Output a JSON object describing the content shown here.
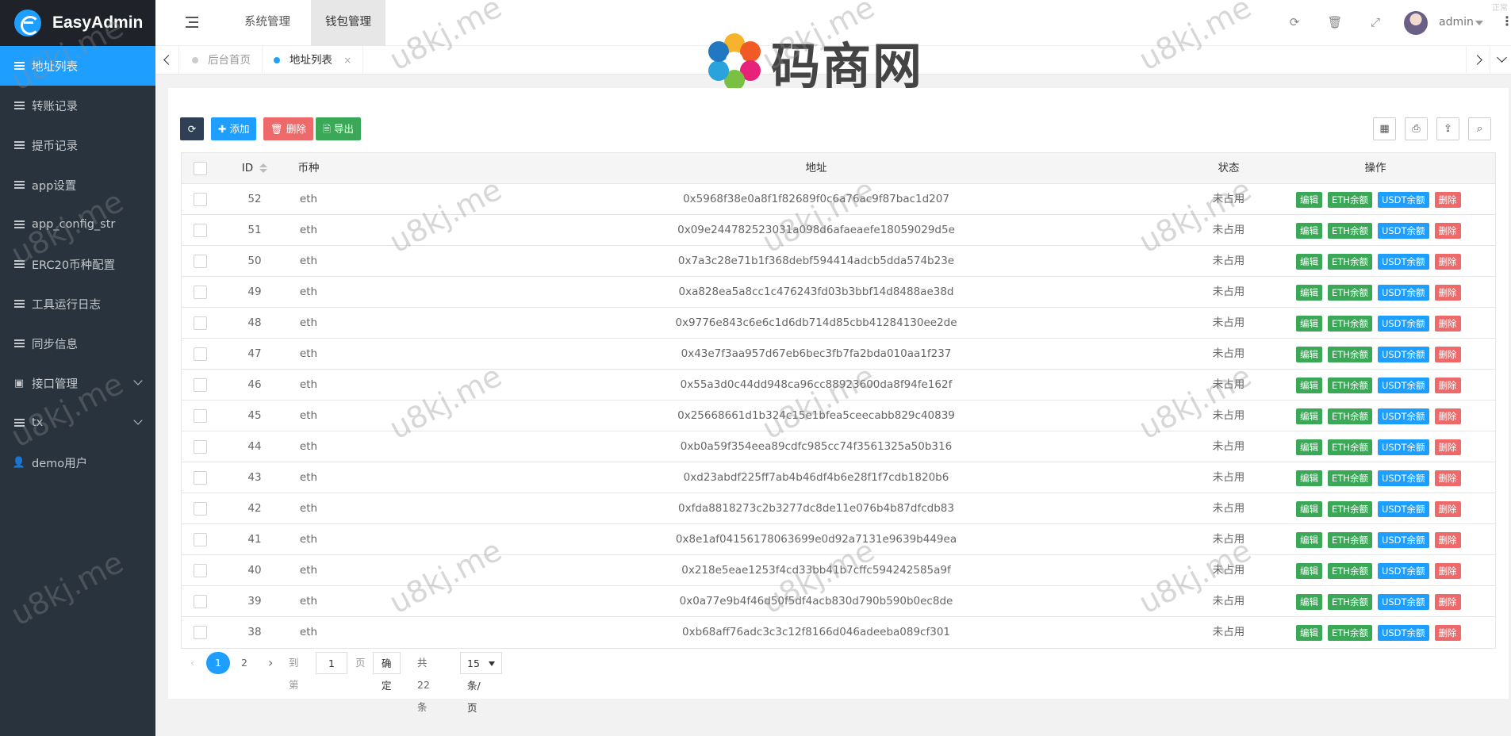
{
  "app": {
    "name": "EasyAdmin"
  },
  "sidebar": {
    "items": [
      {
        "label": "地址列表",
        "active": true,
        "icon": "list-icon"
      },
      {
        "label": "转账记录",
        "icon": "list-icon"
      },
      {
        "label": "提币记录",
        "icon": "list-icon"
      },
      {
        "label": "app设置",
        "icon": "list-icon"
      },
      {
        "label": "app_config_str",
        "icon": "list-icon"
      },
      {
        "label": "ERC20币种配置",
        "icon": "list-icon"
      },
      {
        "label": "工具运行日志",
        "icon": "list-icon"
      },
      {
        "label": "同步信息",
        "icon": "list-icon"
      },
      {
        "label": "接口管理",
        "icon": "id-card-icon",
        "expandable": true
      },
      {
        "label": "tx",
        "icon": "list-icon",
        "expandable": true
      },
      {
        "label": "demo用户",
        "icon": "user-icon"
      }
    ]
  },
  "header": {
    "tabs": [
      {
        "label": "系统管理"
      },
      {
        "label": "钱包管理",
        "active": true
      }
    ],
    "user": "admin",
    "corner_text": "正常"
  },
  "tabbar": {
    "tabs": [
      {
        "label": "后台首页"
      },
      {
        "label": "地址列表",
        "active": true,
        "close": "×"
      }
    ]
  },
  "brand": {
    "text": "码商网"
  },
  "watermark": "u8kj.me",
  "toolbar": {
    "add_label": "添加",
    "delete_label": "删除",
    "export_label": "导出"
  },
  "table": {
    "columns": [
      "ID",
      "币种",
      "地址",
      "状态",
      "操作"
    ],
    "row_actions": [
      "编辑",
      "ETH余额",
      "USDT余额",
      "删除"
    ],
    "rows": [
      {
        "id": "52",
        "coin": "eth",
        "address": "0x5968f38e0a8f1f82689f0c6a76ac9f87bac1d207",
        "status": "未占用"
      },
      {
        "id": "51",
        "coin": "eth",
        "address": "0x09e244782523031a098d6afaeaefe18059029d5e",
        "status": "未占用"
      },
      {
        "id": "50",
        "coin": "eth",
        "address": "0x7a3c28e71b1f368debf594414adcb5dda574b23e",
        "status": "未占用"
      },
      {
        "id": "49",
        "coin": "eth",
        "address": "0xa828ea5a8cc1c476243fd03b3bbf14d8488ae38d",
        "status": "未占用"
      },
      {
        "id": "48",
        "coin": "eth",
        "address": "0x9776e843c6e6c1d6db714d85cbb41284130ee2de",
        "status": "未占用"
      },
      {
        "id": "47",
        "coin": "eth",
        "address": "0x43e7f3aa957d67eb6bec3fb7fa2bda010aa1f237",
        "status": "未占用"
      },
      {
        "id": "46",
        "coin": "eth",
        "address": "0x55a3d0c44dd948ca96cc88923600da8f94fe162f",
        "status": "未占用"
      },
      {
        "id": "45",
        "coin": "eth",
        "address": "0x25668661d1b324c15e1bfea5ceecabb829c40839",
        "status": "未占用"
      },
      {
        "id": "44",
        "coin": "eth",
        "address": "0xb0a59f354eea89cdfc985cc74f3561325a50b316",
        "status": "未占用"
      },
      {
        "id": "43",
        "coin": "eth",
        "address": "0xd23abdf225ff7ab4b46df4b6e28f1f7cdb1820b6",
        "status": "未占用"
      },
      {
        "id": "42",
        "coin": "eth",
        "address": "0xfda8818273c2b3277dc8de11e076b4b87dfcdb83",
        "status": "未占用"
      },
      {
        "id": "41",
        "coin": "eth",
        "address": "0x8e1af04156178063699e0d92a7131e9639b449ea",
        "status": "未占用"
      },
      {
        "id": "40",
        "coin": "eth",
        "address": "0x218e5eae1253f4cd33bb41b7cffc594242585a9f",
        "status": "未占用"
      },
      {
        "id": "39",
        "coin": "eth",
        "address": "0x0a77e9b4f46d50f5df4acb830d790b590b0ec8de",
        "status": "未占用"
      },
      {
        "id": "38",
        "coin": "eth",
        "address": "0xb68aff76adc3c3c12f8166d046adeeba089cf301",
        "status": "未占用"
      }
    ]
  },
  "pagination": {
    "pages": [
      "1",
      "2"
    ],
    "current": "1",
    "goto_prefix": "到第",
    "goto_value": "1",
    "goto_suffix": "页",
    "confirm_label": "确定",
    "total_text": "共 22 条",
    "page_size": "15 条/页"
  }
}
